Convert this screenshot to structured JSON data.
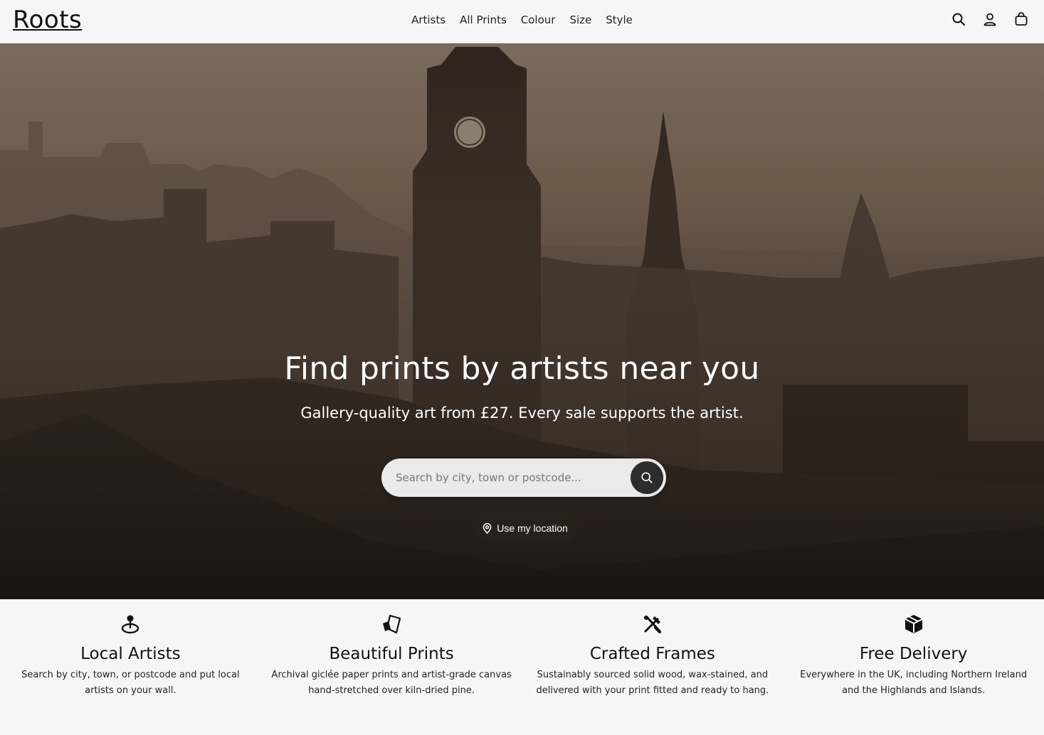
{
  "header": {
    "logo": "Roots",
    "nav": [
      "Artists",
      "All Prints",
      "Colour",
      "Size",
      "Style"
    ],
    "icons": [
      "search-icon",
      "account-icon",
      "bag-icon"
    ]
  },
  "hero": {
    "title": "Find prints by artists near you",
    "subtitle": "Gallery-quality art from £27. Every sale supports the artist.",
    "search_placeholder": "Search by city, town or postcode...",
    "search_value": "",
    "location_button": "Use my location"
  },
  "features": [
    {
      "icon": "map-pin-icon",
      "title": "Local Artists",
      "text": "Search by city, town, or postcode and put local artists on your wall."
    },
    {
      "icon": "print-icon",
      "title": "Beautiful Prints",
      "text": "Archival giclée paper prints and artist-grade canvas hand-stretched over kiln-dried pine."
    },
    {
      "icon": "tools-icon",
      "title": "Crafted Frames",
      "text": "Sustainably sourced solid wood, wax-stained, and delivered with your print fitted and ready to hang."
    },
    {
      "icon": "package-icon",
      "title": "Free Delivery",
      "text": "Everywhere in the UK, including Northern Ireland and the Highlands and Islands."
    }
  ],
  "colors": {
    "background": "#f6f6f6",
    "search_button": "#2c2c2c",
    "text": "#111111"
  }
}
